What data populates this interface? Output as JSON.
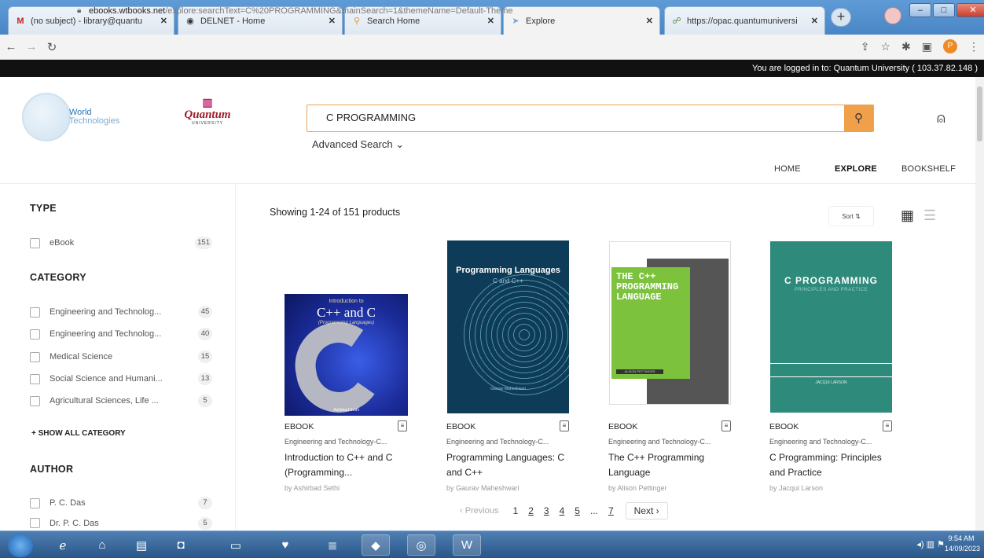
{
  "browser": {
    "tabs": [
      {
        "title": "(no subject) - library@quantu",
        "icon": "gmail-icon"
      },
      {
        "title": "DELNET - Home",
        "icon": "globe-icon"
      },
      {
        "title": "Search Home",
        "icon": "search-icon"
      },
      {
        "title": "Explore",
        "icon": "bookmark-icon"
      },
      {
        "title": "https://opac.quantumuniversi",
        "icon": "link-icon"
      }
    ],
    "url_domain": "ebooks.wtbooks.net",
    "url_path": "/explore:searchText=C%20PROGRAMMING&mainSearch=1&themeName=Default-Theme",
    "profile_initial": "P"
  },
  "site": {
    "logged_in_text": "You are logged in to: Quantum University ( 103.37.82.148 )",
    "wt_logo": {
      "line1": "World",
      "line2": "Technologies"
    },
    "qu_logo": {
      "name": "Quantum",
      "sub": "UNIVERSITY"
    },
    "search": {
      "value": "C PROGRAMMING",
      "advanced_label": "Advanced Search ⌄"
    },
    "nav": {
      "home": "HOME",
      "explore": "EXPLORE",
      "bookshelf": "BOOKSHELF"
    }
  },
  "sidebar": {
    "type_title": "TYPE",
    "type_items": [
      {
        "label": "eBook",
        "count": "151"
      }
    ],
    "category_title": "CATEGORY",
    "category_items": [
      {
        "label": "Engineering and Technolog...",
        "count": "45"
      },
      {
        "label": "Engineering and Technolog...",
        "count": "40"
      },
      {
        "label": "Medical Science",
        "count": "15"
      },
      {
        "label": "Social Science and Humani...",
        "count": "13"
      },
      {
        "label": "Agricultural Sciences, Life ...",
        "count": "5"
      }
    ],
    "show_all": "+ SHOW ALL CATEGORY",
    "author_title": "AUTHOR",
    "author_items": [
      {
        "label": "P. C. Das",
        "count": "7"
      },
      {
        "label": "Dr. P. C. Das",
        "count": "5"
      }
    ]
  },
  "results": {
    "showing": "Showing 1-24 of 151 products",
    "sort_label": "Sort ⇅",
    "books": [
      {
        "format": "EBOOK",
        "category": "Engineering and Technology-C...",
        "title": "Introduction to C++ and C (Programming...",
        "author": "by Ashirbad Sethi",
        "cover": {
          "small": "Introduction to",
          "title": "C++ and C",
          "sub": "(Programming Languages)",
          "author": "Ashirbad Sethi"
        }
      },
      {
        "format": "EBOOK",
        "category": "Engineering and Technology-C...",
        "title": "Programming Languages: C and C++",
        "author": "by Gaurav Maheshwari",
        "cover": {
          "title": "Programming Languages",
          "sub": "C and C++",
          "author": "Gaurav Maheshwari"
        }
      },
      {
        "format": "EBOOK",
        "category": "Engineering and Technology-C...",
        "title": "The C++ Programming Language",
        "author": "by Alison Pettinger",
        "cover": {
          "title": "THE C++ PROGRAMMING LANGUAGE",
          "author": "ALISON PETTINGER"
        }
      },
      {
        "format": "EBOOK",
        "category": "Engineering and Technology-C...",
        "title": "C Programming: Principles and Practice",
        "author": "by Jacqui Larson",
        "cover": {
          "title": "C PROGRAMMING",
          "sub": "PRINCIPLES AND PRACTICE",
          "author": "JACQUI LARSON"
        }
      }
    ],
    "pagination": {
      "prev": "‹ Previous",
      "pages": [
        "1",
        "2",
        "3",
        "4",
        "5",
        "...",
        "7"
      ],
      "next": "Next ›"
    }
  },
  "taskbar": {
    "time": "9:54 AM",
    "date": "14/09/2023"
  },
  "colors": {
    "accent": "#f0a04b",
    "search_border": "#e8a55a",
    "black_bar": "#111111"
  }
}
